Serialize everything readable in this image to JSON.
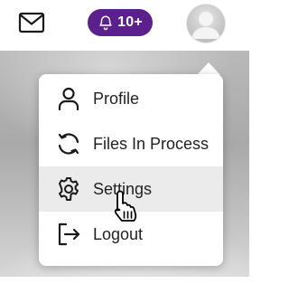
{
  "header": {
    "mail_icon": "mail-icon",
    "notifications": {
      "icon": "bell-icon",
      "count": "10+",
      "color": "#5b1f8e"
    },
    "avatar_icon": "user-avatar-icon"
  },
  "menu": {
    "items": [
      {
        "label": "Profile",
        "icon": "user-icon"
      },
      {
        "label": "Files In Process",
        "icon": "sync-icon"
      },
      {
        "label": "Settings",
        "icon": "gear-icon",
        "hovered": true
      },
      {
        "label": "Logout",
        "icon": "logout-icon"
      }
    ]
  },
  "cursor": {
    "type": "hand-pointer"
  }
}
